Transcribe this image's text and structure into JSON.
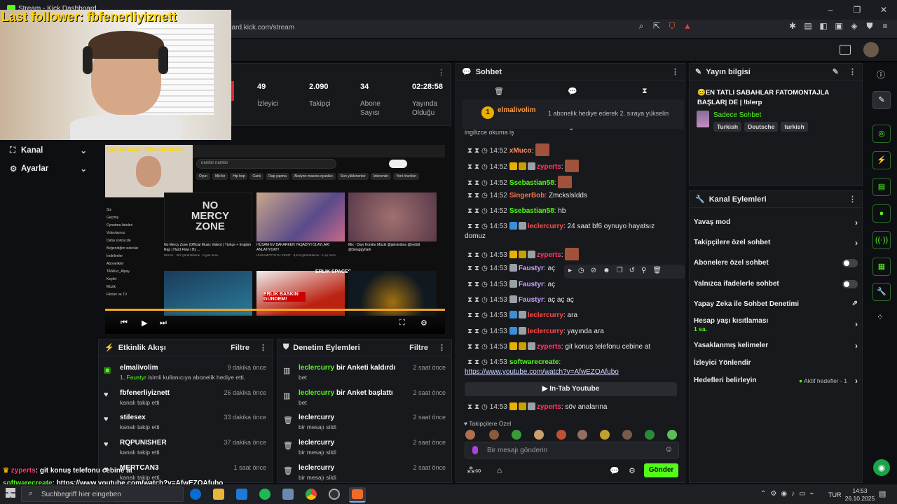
{
  "browser": {
    "tab_title": "Stream - Kick Dashboard",
    "url": "oard.kick.com/stream"
  },
  "overlay": {
    "last_follower": "Last follower: fbfenerliyiznett"
  },
  "stats": [
    {
      "value": "49",
      "label": "İzleyici"
    },
    {
      "value": "2.090",
      "label": "Takipçi"
    },
    {
      "value": "34",
      "label": "Abone Sayısı"
    },
    {
      "value": "02:28:58",
      "label": "Yayında Olduğu"
    }
  ],
  "sidebar": {
    "items": [
      {
        "label": "Kanal"
      },
      {
        "label": "Ayarlar"
      }
    ]
  },
  "preview": {
    "search": "nambir nambir",
    "chips": [
      "Oyun",
      "Mix'ler",
      "Hip hop",
      "Canlı",
      "Rap yapma",
      "Aksiyon-macera oyunları",
      "Son yüklenenler",
      "İzlenenler",
      "Yeni önerilen"
    ],
    "videos": [
      {
        "title": "No Mercy Zone (Official Music Video) | Türkçe + English Rap | Hard Flow | By ...",
        "meta": "ISHAK · 267 görüntüleme · 5 gün önce",
        "thumb": "NO MERCY ZONE"
      },
      {
        "title": "HÜSAM EV BAKARKEN YAŞADIYI OLAYLARI ANLATIYOR!!!",
        "meta": "HUSAMYPTUYU KESIT · 8,5 B görüntüleme · 1 ay önce",
        "thumb": ""
      },
      {
        "title": "Mix - Dayı Kombe Müzik @jahninibos @reddit @Swaggyhark",
        "meta": "",
        "thumb": ""
      }
    ],
    "side": [
      "Siz",
      "Geçmiş",
      "Oynatma listeleri",
      "Videolarınız",
      "Daha sonra izle",
      "Beğendiğim videolar",
      "İndirilenler",
      "Abonelikler",
      "TANKer_Alpay",
      "Keşfet",
      "Müzik",
      "Filmler ve TV"
    ],
    "spaces_label": "ERLIK SPACES",
    "gundem_label": "ERLİK BASKIN GÜNDEM!"
  },
  "activity": {
    "title": "Etkinlik Akışı",
    "filter": "Filtre",
    "items": [
      {
        "name": "elmalivolim",
        "sub_user": "1, Faustyr",
        "sub": "isimli kullanıcıya abonelik hediye etti.",
        "time": "9 dakika önce",
        "icon": "gift-icon"
      },
      {
        "name": "fbfenerliyiznett",
        "sub_user": "",
        "sub": "kanalı takip etti",
        "time": "26 dakika önce",
        "icon": "heart-icon"
      },
      {
        "name": "stilesex",
        "sub_user": "",
        "sub": "kanalı takip etti",
        "time": "33 dakika önce",
        "icon": "heart-icon"
      },
      {
        "name": "RQPUNISHER",
        "sub_user": "",
        "sub": "kanalı takip etti",
        "time": "37 dakika önce",
        "icon": "heart-icon"
      },
      {
        "name": "MERTCAN3",
        "sub_user": "",
        "sub": "kanalı takip etti",
        "time": "1 saat önce",
        "icon": "heart-icon"
      }
    ]
  },
  "moderation": {
    "title": "Denetim Eylemleri",
    "filter": "Filtre",
    "items": [
      {
        "user": "leclercurry",
        "action": "bir Anketi kaldırdı",
        "sub": "bet",
        "time": "2 saat önce",
        "icon": "poll-icon"
      },
      {
        "user": "leclercurry",
        "action": "bir Anket başlattı",
        "sub": "bet",
        "time": "2 saat önce",
        "icon": "poll-icon"
      },
      {
        "user": "leclercurry",
        "action": "",
        "sub": "bir mesajı sildi",
        "time": "2 saat önce",
        "icon": "trash-icon"
      },
      {
        "user": "leclercurry",
        "action": "",
        "sub": "bir mesajı sildi",
        "time": "2 saat önce",
        "icon": "trash-icon"
      },
      {
        "user": "leclercurry",
        "action": "",
        "sub": "bir mesajı sildi",
        "time": "2 saat önce",
        "icon": "trash-icon"
      }
    ]
  },
  "chat": {
    "title": "Sohbet",
    "pinned_user": "elmalivolim",
    "pinned_count": "1",
    "pinned_text": "1 abonelik hediye ederek 2. sıraya yükselin",
    "overflow_text": "ingilizce okuma iş",
    "messages": [
      {
        "time": "14:52",
        "user": "xMuco",
        "color": "#ff8a65",
        "text": "",
        "emote": true,
        "badges": []
      },
      {
        "time": "14:52",
        "user": "zyperts",
        "color": "#ff3b6b",
        "text": "",
        "emote": true,
        "badges": [
          "#e8b000",
          "#c8a000",
          "#9aa0a6"
        ]
      },
      {
        "time": "14:52",
        "user": "Ssebastian58",
        "color": "#53fc18",
        "text": "",
        "emote": true,
        "badges": []
      },
      {
        "time": "14:52",
        "user": "SingerBob",
        "color": "#ff7043",
        "text": "Zmckslsldds",
        "emote": false,
        "badges": []
      },
      {
        "time": "14:52",
        "user": "Ssebastian58",
        "color": "#53fc18",
        "text": "hb",
        "emote": false,
        "badges": []
      },
      {
        "time": "14:53",
        "user": "leclercurry",
        "color": "#ff4d4d",
        "text": "24 saat bf6 oynuyo hayatsız",
        "text2": "domuz",
        "emote": false,
        "badges": [
          "#3a8fd8",
          "#9aa0a6"
        ]
      },
      {
        "time": "14:53",
        "user": "zyperts",
        "color": "#ff3b6b",
        "text": "",
        "emote": true,
        "badges": [
          "#e8b000",
          "#c8a000",
          "#9aa0a6"
        ]
      },
      {
        "time": "14:53",
        "user": "Faustyr",
        "color": "#c9a0ff",
        "text": "aç",
        "emote": false,
        "badges": [
          "#9aa0a6"
        ]
      },
      {
        "time": "14:53",
        "user": "Faustyr",
        "color": "#c9a0ff",
        "text": "aç",
        "emote": false,
        "badges": [
          "#9aa0a6"
        ]
      },
      {
        "time": "14:53",
        "user": "Faustyr",
        "color": "#c9a0ff",
        "text": "aç aç aç",
        "emote": false,
        "badges": [
          "#9aa0a6"
        ]
      },
      {
        "time": "14:53",
        "user": "leclercurry",
        "color": "#ff4d4d",
        "text": "ara",
        "emote": false,
        "badges": [
          "#3a8fd8",
          "#9aa0a6"
        ]
      },
      {
        "time": "14:53",
        "user": "leclercurry",
        "color": "#ff4d4d",
        "text": "yayında ara",
        "emote": false,
        "badges": [
          "#3a8fd8",
          "#9aa0a6"
        ]
      },
      {
        "time": "14:53",
        "user": "zyperts",
        "color": "#ff3b6b",
        "text": "git konuş telefonu cebine at",
        "emote": false,
        "badges": [
          "#e8b000",
          "#c8a000",
          "#9aa0a6"
        ]
      },
      {
        "time": "14:53",
        "user": "softwarecreate",
        "color": "#53fc18",
        "text": "",
        "link": "https://www.youtube.com/watch?v=AfwEZOAfubo",
        "emote": false,
        "badges": []
      },
      {
        "time": "14:53",
        "user": "zyperts",
        "color": "#ff3b6b",
        "text": "söv analarına",
        "emote": false,
        "badges": [
          "#e8b000",
          "#c8a000",
          "#9aa0a6"
        ]
      }
    ],
    "youtube_button": "In-Tab Youtube",
    "followers_only": "Takipçilere Özel",
    "input_placeholder": "Bir mesajı gönderin",
    "send": "Gönder"
  },
  "stream_info": {
    "title": "Yayın bilgisi",
    "stream_title": "😊EN TATLI SABAHLAR FATOMONTAJLA BAŞLAR| DE | !blerp",
    "category": "Sadece Sohbet",
    "tags": [
      "Turkish",
      "Deutsche",
      "turkish"
    ]
  },
  "channel_actions": {
    "title": "Kanal Eylemleri",
    "items": [
      {
        "label": "Yavaş mod",
        "control": "chevron"
      },
      {
        "label": "Takipçilere özel sohbet",
        "control": "chevron"
      },
      {
        "label": "Abonelere özel sohbet",
        "control": "toggle"
      },
      {
        "label": "Yalnızca ifadelerle sohbet",
        "control": "toggle"
      },
      {
        "label": "Yapay Zeka ile Sohbet Denetimi",
        "control": "external"
      },
      {
        "label": "Hesap yaşı kısıtlaması",
        "sub": "1 sa.",
        "control": "chevron"
      },
      {
        "label": "Yasaklanmış kelimeler",
        "control": "chevron"
      },
      {
        "label": "İzleyici Yönlendir",
        "control": "none"
      },
      {
        "label": "Hedefleri belirleyin",
        "status": "Aktif hedefler - 1",
        "control": "chevron"
      }
    ]
  },
  "bottom_overlay": {
    "line1_user": "zyperts",
    "line1_text": "git konuş telefonu cebine at",
    "line2_user": "softwarecreate",
    "line2_text": "https://www.youtube.com/watch?v=AfwEZOAfubo"
  },
  "taskbar": {
    "search": "Suchbegriff hier eingeben",
    "lang": "TUR",
    "time": "14:53",
    "date": "26.10.2025"
  },
  "colors": {
    "accent": "#53fc18",
    "panel": "#18191d",
    "bg": "#0e0f12"
  }
}
